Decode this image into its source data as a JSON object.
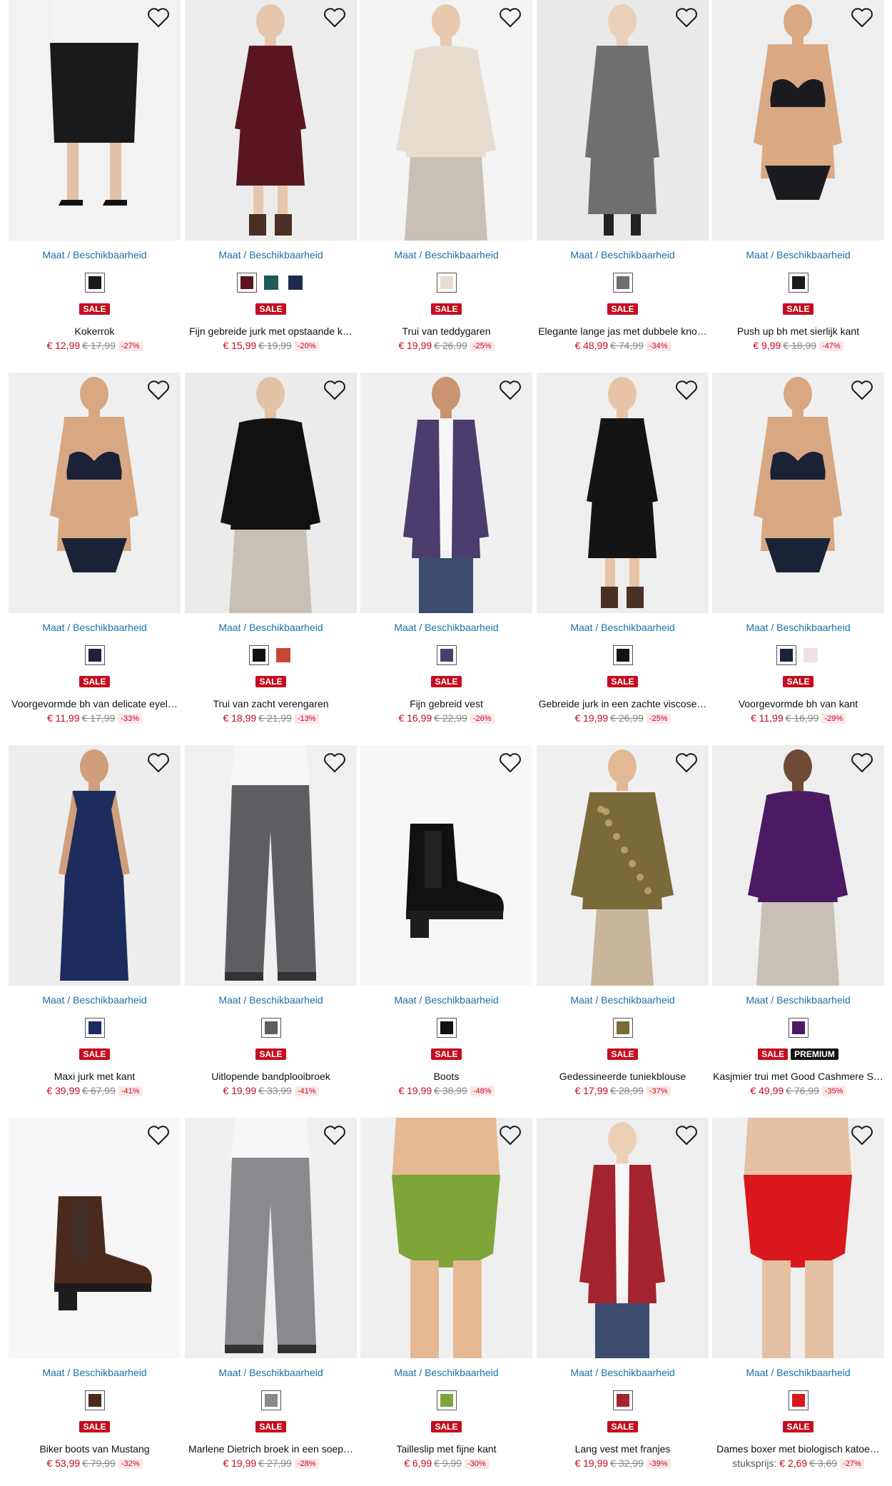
{
  "ui": {
    "size_link": "Maat / Beschikbaarheid",
    "sale_badge": "SALE",
    "premium_badge": "PREMIUM"
  },
  "colors": {
    "link": "#1d6fa5",
    "sale": "#c40d1e",
    "badge_dark": "#111111"
  },
  "products": [
    {
      "name": "Kokerrok",
      "price": "€ 12,99",
      "old_price": "€ 17,99",
      "discount": "-27%",
      "bg": "#f2f2f2",
      "garment": "#1a1a1a",
      "skin": "#e2c0a5",
      "shape": "skirt",
      "swatches": [
        "#1a1a1a"
      ]
    },
    {
      "name": "Fijn gebreide jurk met opstaande k…",
      "price": "€ 15,99",
      "old_price": "€ 19,99",
      "discount": "-20%",
      "bg": "#ececec",
      "garment": "#5a1620",
      "skin": "#e6c6ad",
      "shape": "dress",
      "swatches": [
        "#5a1620",
        "#1d5a5a",
        "#1c2b4a"
      ]
    },
    {
      "name": "Trui van teddygaren",
      "price": "€ 19,99",
      "old_price": "€ 26,99",
      "discount": "-25%",
      "bg": "#f3f3f3",
      "garment": "#e6ddd0",
      "skin": "#e8c9ad",
      "shape": "sweater",
      "swatches": [
        "#e6ddd0"
      ]
    },
    {
      "name": "Elegante lange jas met dubbele kno…",
      "price": "€ 48,99",
      "old_price": "€ 74,99",
      "discount": "-34%",
      "bg": "#e9e9e9",
      "garment": "#6f6f6f",
      "skin": "#ead0b8",
      "shape": "coat",
      "swatches": [
        "#6f6f6f"
      ]
    },
    {
      "name": "Push up bh met sierlijk kant",
      "price": "€ 9,99",
      "old_price": "€ 18,99",
      "discount": "-47%",
      "bg": "#eeeeee",
      "garment": "#1b1b1f",
      "skin": "#d9a984",
      "shape": "lingerie",
      "swatches": [
        "#1b1b1f"
      ]
    },
    {
      "name": "Voorgevormde bh van delicate eyel…",
      "price": "€ 11,99",
      "old_price": "€ 17,99",
      "discount": "-33%",
      "bg": "#efefef",
      "garment": "#1b2238",
      "skin": "#d7a882",
      "shape": "lingerie",
      "swatches": [
        "#1b2238"
      ]
    },
    {
      "name": "Trui van zacht verengaren",
      "price": "€ 18,99",
      "old_price": "€ 21,99",
      "discount": "-13%",
      "bg": "#ebebeb",
      "garment": "#111111",
      "skin": "#e4c2a6",
      "shape": "sweater",
      "swatches": [
        "#111111",
        "#c6463a"
      ]
    },
    {
      "name": "Fijn gebreid vest",
      "price": "€ 16,99",
      "old_price": "€ 22,99",
      "discount": "-26%",
      "bg": "#efefef",
      "garment": "#4b3d6e",
      "skin": "#c99472",
      "shape": "cardigan",
      "swatches": [
        "#4b3d6e"
      ]
    },
    {
      "name": "Gebreide jurk in een zachte viscose…",
      "price": "€ 19,99",
      "old_price": "€ 26,99",
      "discount": "-25%",
      "bg": "#eeeeee",
      "garment": "#141414",
      "skin": "#e7c4a7",
      "shape": "dress",
      "swatches": [
        "#141414"
      ]
    },
    {
      "name": "Voorgevormde bh van kant",
      "price": "€ 11,99",
      "old_price": "€ 16,99",
      "discount": "-29%",
      "bg": "#efefef",
      "garment": "#1a2236",
      "skin": "#d7a882",
      "shape": "lingerie",
      "swatches": [
        "#1a2236",
        "#f2dfe2"
      ]
    },
    {
      "name": "Maxi jurk met kant",
      "price": "€ 39,99",
      "old_price": "€ 67,99",
      "discount": "-41%",
      "bg": "#ededed",
      "garment": "#1c2c5c",
      "skin": "#cf9f7c",
      "shape": "gown",
      "swatches": [
        "#1c2c5c"
      ]
    },
    {
      "name": "Uitlopende bandplooibroek",
      "price": "€ 19,99",
      "old_price": "€ 33,99",
      "discount": "-41%",
      "bg": "#f0f0f0",
      "garment": "#5e5e62",
      "skin": "#e5c3a7",
      "shape": "trousers",
      "swatches": [
        "#5e5e62"
      ]
    },
    {
      "name": "Boots",
      "price": "€ 19,99",
      "old_price": "€ 38,99",
      "discount": "-48%",
      "bg": "#f7f7f7",
      "garment": "#111111",
      "skin": "#f7f7f7",
      "shape": "boot",
      "swatches": [
        "#111111"
      ]
    },
    {
      "name": "Gedessineerde tuniekblouse",
      "price": "€ 17,99",
      "old_price": "€ 28,99",
      "discount": "-37%",
      "bg": "#efefef",
      "garment": "#7a6a3a",
      "skin": "#e1b995",
      "shape": "blouse",
      "swatches": [
        "#7a6a3a"
      ]
    },
    {
      "name": "Kasjmier trui met Good Cashmere S…",
      "price": "€ 49,99",
      "old_price": "€ 76,99",
      "discount": "-35%",
      "bg": "#eeeeee",
      "garment": "#4c1a63",
      "skin": "#6f4a36",
      "shape": "sweater",
      "swatches": [
        "#4c1a63"
      ],
      "premium": true
    },
    {
      "name": "Biker boots van Mustang",
      "price": "€ 53,99",
      "old_price": "€ 79,99",
      "discount": "-32%",
      "bg": "#f7f7f7",
      "garment": "#4b2a1c",
      "skin": "#f7f7f7",
      "shape": "boot",
      "swatches": [
        "#4b2a1c"
      ]
    },
    {
      "name": "Marlene Dietrich broek in een soep…",
      "price": "€ 19,99",
      "old_price": "€ 27,99",
      "discount": "-28%",
      "bg": "#efefef",
      "garment": "#8a8a8e",
      "skin": "#e5c3a7",
      "shape": "trousers",
      "swatches": [
        "#8a8a8e"
      ]
    },
    {
      "name": "Tailleslip met fijne kant",
      "price": "€ 6,99",
      "old_price": "€ 9,99",
      "discount": "-30%",
      "bg": "#efefef",
      "garment": "#7ea53a",
      "skin": "#e4b993",
      "shape": "brief",
      "swatches": [
        "#7ea53a"
      ]
    },
    {
      "name": "Lang vest met franjes",
      "price": "€ 19,99",
      "old_price": "€ 32,99",
      "discount": "-39%",
      "bg": "#eeeeee",
      "garment": "#a3242e",
      "skin": "#ecd0b6",
      "shape": "cardigan",
      "swatches": [
        "#a3242e"
      ]
    },
    {
      "name": "Dames boxer met biologisch katoe…",
      "price": "€ 2,69",
      "old_price": "€ 3,69",
      "discount": "-27%",
      "unit_prefix": "stuksprijs:",
      "bg": "#efefef",
      "garment": "#d8181c",
      "skin": "#e6c0a2",
      "shape": "brief",
      "swatches": [
        "#d8181c"
      ]
    }
  ]
}
